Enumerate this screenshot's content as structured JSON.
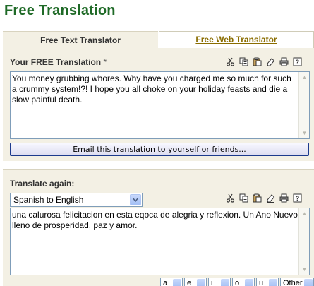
{
  "page_title": "Free Translation",
  "tabs": [
    {
      "label": "Free Text Translator",
      "active": true
    },
    {
      "label": "Free Web Translator",
      "active": false
    }
  ],
  "result": {
    "label": "Your FREE Translation",
    "required_mark": "*",
    "text": "You money grubbing whores.  Why have you charged me so much for such a crummy system!?!  I hope you all choke on your holiday feasts and die a slow painful death."
  },
  "toolbar_icons": [
    "cut-icon",
    "copy-icon",
    "paste-icon",
    "erase-icon",
    "print-icon",
    "help-icon"
  ],
  "email_button": "Email this translation to yourself or friends...",
  "translate_again": {
    "label": "Translate again:",
    "language_pair": "Spanish to English",
    "text": "una calurosa felicitacion en esta eqoca de alegria y reflexion.  Un Ano Nuevo lleno de prosperidad, paz y amor."
  },
  "accent_selectors": [
    "a",
    "e",
    "i",
    "o",
    "u",
    "Other"
  ],
  "colors": {
    "title": "#1f6a27",
    "panel": "#f3f0e4",
    "link": "#8a6d00",
    "button_border": "#1c3a8c"
  }
}
